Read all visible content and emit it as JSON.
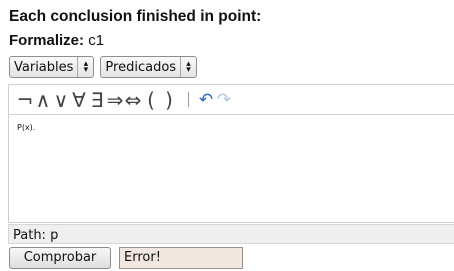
{
  "header": {
    "title": "Each conclusion finished in point:"
  },
  "formalize": {
    "label": "Formalize:",
    "value": "c1"
  },
  "selects": {
    "variables": "Variables",
    "predicados": "Predicados"
  },
  "toolbar": {
    "symbols": [
      "¬",
      "∧",
      "∨",
      "∀",
      "∃",
      "⇒",
      "⇔",
      "(",
      ")"
    ],
    "undo_icon": "undo-icon",
    "redo_icon": "redo-icon"
  },
  "editor": {
    "content": "P(x)."
  },
  "path": {
    "text": "Path: p"
  },
  "buttons": {
    "check_label": "Comprobar"
  },
  "status": {
    "message": "Error!"
  }
}
